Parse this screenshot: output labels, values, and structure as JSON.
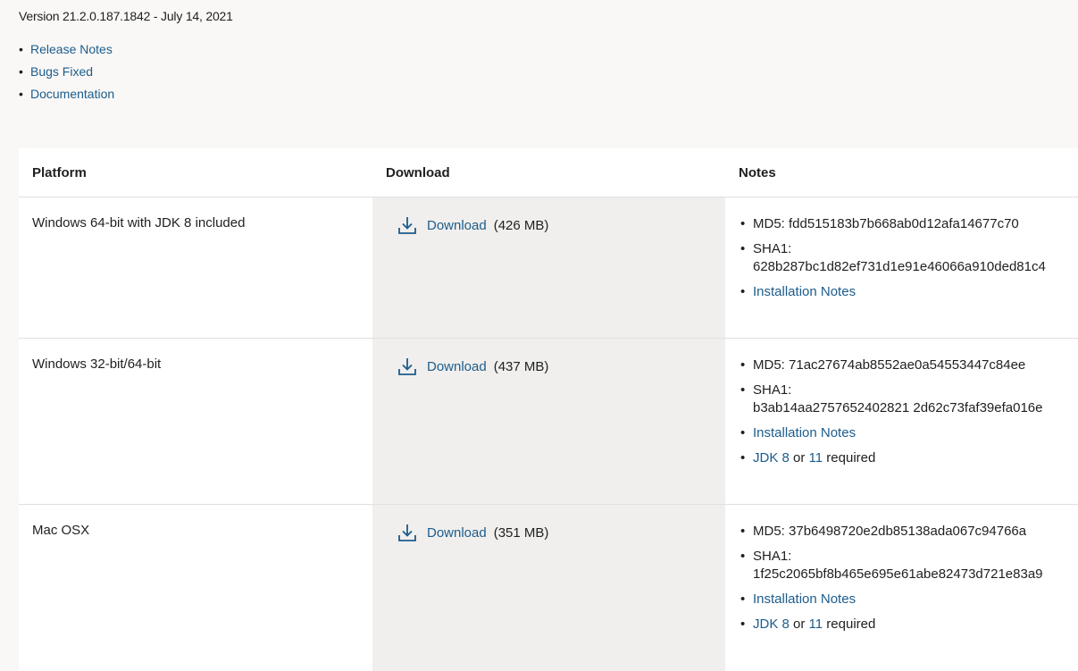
{
  "version_line": "Version 21.2.0.187.1842 - July 14, 2021",
  "top_links": [
    "Release Notes",
    "Bugs Fixed",
    "Documentation"
  ],
  "bullet": "•",
  "table": {
    "headers": [
      "Platform",
      "Download",
      "Notes"
    ],
    "download_label": "Download",
    "rows": [
      {
        "platform": "Windows 64-bit with JDK 8 included",
        "size": "(426 MB)",
        "md5": "MD5: fdd515183b7b668ab0d12afa14677c70",
        "sha1_label": "SHA1:",
        "sha1": "628b287bc1d82ef731d1e91e46066a910ded81c4",
        "install_notes": "Installation Notes"
      },
      {
        "platform": "Windows 32-bit/64-bit",
        "size": "(437 MB)",
        "md5": "MD5: 71ac27674ab8552ae0a54553447c84ee",
        "sha1_label": "SHA1:",
        "sha1": "b3ab14aa2757652402821 2d62c73faf39efa016e",
        "install_notes": "Installation Notes",
        "jdk8": "JDK 8",
        "or": " or ",
        "jdk11": "11",
        "required": " required"
      },
      {
        "platform": "Mac OSX",
        "size": "(351 MB)",
        "md5": "MD5: 37b6498720e2db85138ada067c94766a",
        "sha1_label": "SHA1:",
        "sha1": "1f25c2065bf8b465e695e61abe82473d721e83a9",
        "install_notes": "Installation Notes",
        "jdk8": "JDK 8",
        "or": " or ",
        "jdk11": "11",
        "required": " required"
      }
    ]
  },
  "colors": {
    "link": "#1c5c8c",
    "download_cell_bg": "#f0efed",
    "page_bg": "#f9f8f6"
  },
  "icons": {
    "download": "download-arrow-icon"
  }
}
